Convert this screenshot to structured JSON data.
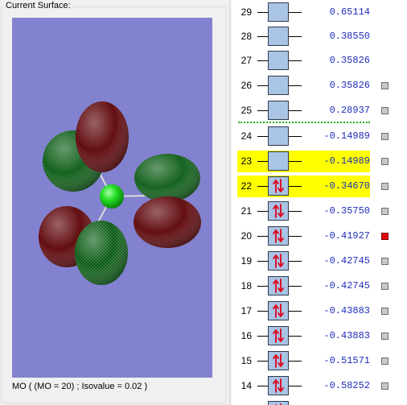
{
  "surface_panel": {
    "title": "Current Surface:",
    "status": "MO ( (MO = 20) ; Isovalue = 0.02 )"
  },
  "colors": {
    "viewport_bg": "#8282d0",
    "lobe_positive": "#1e7a2a",
    "lobe_negative": "#7a1418",
    "atom": "#22dd22",
    "energy_text": "#1f2cb8",
    "highlight": "#ffff00",
    "separator": "#12b012",
    "selected_checkbox": "#e8000a"
  },
  "orbitals": [
    {
      "index": "29",
      "energy": "0.65114",
      "occupied": false,
      "highlighted": false,
      "checkbox": "none"
    },
    {
      "index": "28",
      "energy": "0.38550",
      "occupied": false,
      "highlighted": false,
      "checkbox": "none"
    },
    {
      "index": "27",
      "energy": "0.35826",
      "occupied": false,
      "highlighted": false,
      "checkbox": "none"
    },
    {
      "index": "26",
      "energy": "0.35826",
      "occupied": false,
      "highlighted": false,
      "checkbox": "gray"
    },
    {
      "index": "25",
      "energy": "0.28937",
      "occupied": false,
      "highlighted": false,
      "checkbox": "gray"
    },
    {
      "index": "24",
      "energy": "-0.14989",
      "occupied": false,
      "highlighted": false,
      "checkbox": "gray"
    },
    {
      "index": "23",
      "energy": "-0.14989",
      "occupied": false,
      "highlighted": true,
      "checkbox": "gray"
    },
    {
      "index": "22",
      "energy": "-0.34670",
      "occupied": true,
      "highlighted": true,
      "checkbox": "gray"
    },
    {
      "index": "21",
      "energy": "-0.35750",
      "occupied": true,
      "highlighted": false,
      "checkbox": "gray"
    },
    {
      "index": "20",
      "energy": "-0.41927",
      "occupied": true,
      "highlighted": false,
      "checkbox": "red"
    },
    {
      "index": "19",
      "energy": "-0.42745",
      "occupied": true,
      "highlighted": false,
      "checkbox": "gray"
    },
    {
      "index": "18",
      "energy": "-0.42745",
      "occupied": true,
      "highlighted": false,
      "checkbox": "gray"
    },
    {
      "index": "17",
      "energy": "-0.43883",
      "occupied": true,
      "highlighted": false,
      "checkbox": "gray"
    },
    {
      "index": "16",
      "energy": "-0.43883",
      "occupied": true,
      "highlighted": false,
      "checkbox": "gray"
    },
    {
      "index": "15",
      "energy": "-0.51571",
      "occupied": true,
      "highlighted": false,
      "checkbox": "gray"
    },
    {
      "index": "14",
      "energy": "-0.58252",
      "occupied": true,
      "highlighted": false,
      "checkbox": "gray"
    },
    {
      "index": "",
      "energy": "",
      "occupied": true,
      "highlighted": false,
      "checkbox": "none"
    }
  ]
}
